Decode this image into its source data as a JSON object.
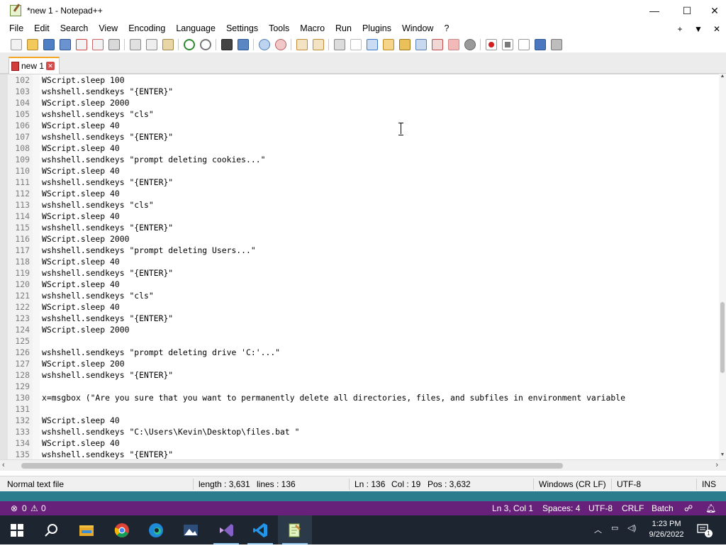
{
  "window": {
    "title": "*new 1 - Notepad++",
    "minimize_glyph": "—",
    "maximize_glyph": "☐",
    "close_glyph": "✕"
  },
  "menu": {
    "items": [
      "File",
      "Edit",
      "Search",
      "View",
      "Encoding",
      "Language",
      "Settings",
      "Tools",
      "Macro",
      "Run",
      "Plugins",
      "Window",
      "?"
    ],
    "right_controls": [
      "+",
      "▼",
      "✕"
    ]
  },
  "toolbar": {
    "icons": [
      "new-file-icon",
      "open-file-icon",
      "save-icon",
      "save-all-icon",
      "close-icon",
      "close-all-icon",
      "print-icon",
      "cut-icon",
      "copy-icon",
      "paste-icon",
      "undo-icon",
      "redo-icon",
      "find-icon",
      "replace-icon",
      "zoom-in-icon",
      "zoom-out-icon",
      "sync-vertical-icon",
      "sync-horizontal-icon",
      "word-wrap-icon",
      "show-all-characters-icon",
      "indent-guide-icon",
      "document-map-icon",
      "function-list-icon",
      "folder-workspace-icon",
      "monitoring-icon",
      "record-macro-icon",
      "stop-macro-icon",
      "play-macro-icon",
      "run-macro-multiple-icon",
      "save-macro-icon"
    ]
  },
  "tabs": [
    {
      "label": "new 1",
      "close": "✕"
    }
  ],
  "editor": {
    "lines": [
      {
        "n": "102",
        "text": "WScript.sleep 100"
      },
      {
        "n": "103",
        "text": "wshshell.sendkeys \"{ENTER}\""
      },
      {
        "n": "104",
        "text": "WScript.sleep 2000"
      },
      {
        "n": "105",
        "text": "wshshell.sendkeys \"cls\""
      },
      {
        "n": "106",
        "text": "WScript.sleep 40"
      },
      {
        "n": "107",
        "text": "wshshell.sendkeys \"{ENTER}\""
      },
      {
        "n": "108",
        "text": "WScript.sleep 40"
      },
      {
        "n": "109",
        "text": "wshshell.sendkeys \"prompt deleting cookies...\""
      },
      {
        "n": "110",
        "text": "WScript.sleep 40"
      },
      {
        "n": "111",
        "text": "wshshell.sendkeys \"{ENTER}\""
      },
      {
        "n": "112",
        "text": "WScript.sleep 40"
      },
      {
        "n": "113",
        "text": "wshshell.sendkeys \"cls\""
      },
      {
        "n": "114",
        "text": "WScript.sleep 40"
      },
      {
        "n": "115",
        "text": "wshshell.sendkeys \"{ENTER}\""
      },
      {
        "n": "116",
        "text": "WScript.sleep 2000"
      },
      {
        "n": "117",
        "text": "wshshell.sendkeys \"prompt deleting Users...\""
      },
      {
        "n": "118",
        "text": "WScript.sleep 40"
      },
      {
        "n": "119",
        "text": "wshshell.sendkeys \"{ENTER}\""
      },
      {
        "n": "120",
        "text": "WScript.sleep 40"
      },
      {
        "n": "121",
        "text": "wshshell.sendkeys \"cls\""
      },
      {
        "n": "122",
        "text": "WScript.sleep 40"
      },
      {
        "n": "123",
        "text": "wshshell.sendkeys \"{ENTER}\""
      },
      {
        "n": "124",
        "text": "WScript.sleep 2000"
      },
      {
        "n": "125",
        "text": ""
      },
      {
        "n": "126",
        "text": "wshshell.sendkeys \"prompt deleting drive 'C:'...\""
      },
      {
        "n": "127",
        "text": "WScript.sleep 200"
      },
      {
        "n": "128",
        "text": "wshshell.sendkeys \"{ENTER}\""
      },
      {
        "n": "129",
        "text": ""
      },
      {
        "n": "130",
        "text": "x=msgbox (\"Are you sure that you want to permanently delete all directories, files, and subfiles in environment variable"
      },
      {
        "n": "131",
        "text": ""
      },
      {
        "n": "132",
        "text": "WScript.sleep 40"
      },
      {
        "n": "133",
        "text": "wshshell.sendkeys \"C:\\Users\\Kevin\\Desktop\\files.bat \""
      },
      {
        "n": "134",
        "text": "WScript.sleep 40"
      },
      {
        "n": "135",
        "text": "wshshell.sendkeys \"{ENTER}\""
      }
    ]
  },
  "status": {
    "file_type": "Normal text file",
    "length": "length : 3,631",
    "lines": "lines : 136",
    "ln": "Ln : 136",
    "col": "Col : 19",
    "pos": "Pos : 3,632",
    "eol": "Windows (CR LF)",
    "encoding": "UTF-8",
    "mode": "INS"
  },
  "vscode_status": {
    "errors": "0",
    "warnings": "0",
    "cursor": "Ln 3, Col 1",
    "spaces": "Spaces: 4",
    "encoding": "UTF-8",
    "eol": "CRLF",
    "language": "Batch"
  },
  "taskbar": {
    "apps": [
      "start-icon",
      "search-icon",
      "file-explorer-icon",
      "chrome-icon",
      "edge-icon",
      "photos-icon",
      "visual-studio-icon",
      "vscode-icon",
      "notepadpp-icon"
    ],
    "time": "1:23 PM",
    "date": "9/26/2022",
    "notification_count": "1"
  },
  "colors": {
    "vscode_status_bg": "#68217a",
    "taskbar_bg": "#1c2530",
    "tab_accent": "#f5a623"
  }
}
